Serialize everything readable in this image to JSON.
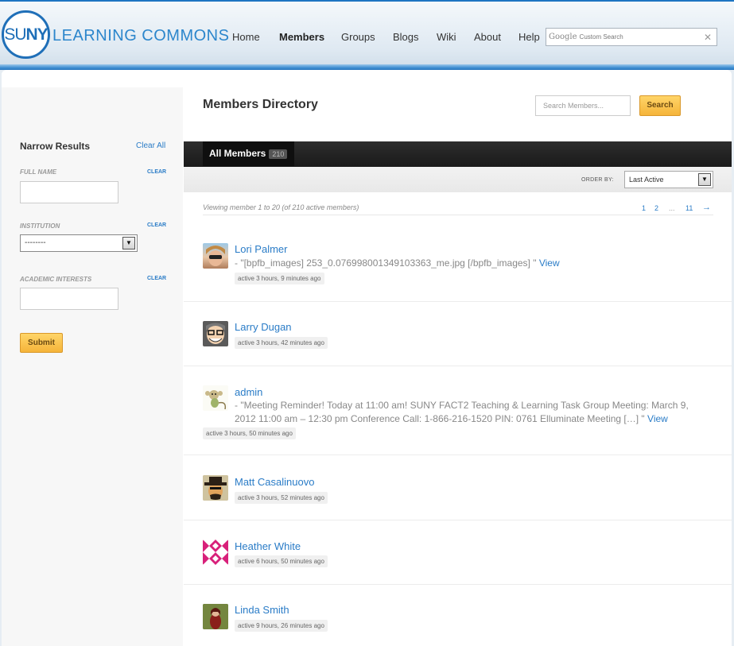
{
  "header": {
    "logo_su": "SU",
    "logo_ny": "NY",
    "logo_text": "LEARNING COMMONS",
    "nav": [
      "Home",
      "Members",
      "Groups",
      "Blogs",
      "Wiki",
      "About",
      "Help"
    ],
    "search_google": "Google",
    "search_placeholder": "Custom Search",
    "search_clear": "✕"
  },
  "directory": {
    "title": "Members Directory",
    "search_placeholder": "Search Members...",
    "search_button": "Search"
  },
  "sidebar": {
    "title": "Narrow Results",
    "clear_all": "Clear All",
    "full_name_label": "FULL NAME",
    "institution_label": "INSTITUTION",
    "institution_value": "--------",
    "interests_label": "ACADEMIC INTERESTS",
    "clear": "CLEAR",
    "submit": "Submit"
  },
  "tabs": {
    "all_members": "All Members",
    "count": "210"
  },
  "filter": {
    "order_by": "ORDER BY:",
    "order_value": "Last Active"
  },
  "pagination": {
    "viewing": "Viewing member 1 to 20 (of 210 active members)",
    "pages": [
      "1",
      "2",
      "...",
      "11",
      "→"
    ]
  },
  "members": [
    {
      "name": "Lori Palmer",
      "update": "- \"[bpfb_images] 253_0.076998001349103363_me.jpg [/bpfb_images] \"",
      "view": "View",
      "active": "active 3 hours, 9 minutes ago"
    },
    {
      "name": "Larry Dugan",
      "active": "active 3 hours, 42 minutes ago"
    },
    {
      "name": "admin",
      "update_line1": "- \"Meeting Reminder! Today at 11:00 am! SUNY FACT2 Teaching & Learning Task Group Meeting: March 9,",
      "update_line2": "2012 11:00 am – 12:30 pm Conference Call: 1-866-216-1520 PIN: 0761 Elluminate Meeting […] \"",
      "view": "View",
      "active": "active 3 hours, 50 minutes ago"
    },
    {
      "name": "Matt Casalinuovo",
      "active": "active 3 hours, 52 minutes ago"
    },
    {
      "name": "Heather White",
      "active": "active 6 hours, 50 minutes ago"
    },
    {
      "name": "Linda Smith",
      "active": "active 9 hours, 26 minutes ago"
    }
  ],
  "colors": {
    "accent_blue": "#2a7cc7",
    "brand_blue": "#1f6fb8",
    "button_orange": "#f5b43a"
  }
}
